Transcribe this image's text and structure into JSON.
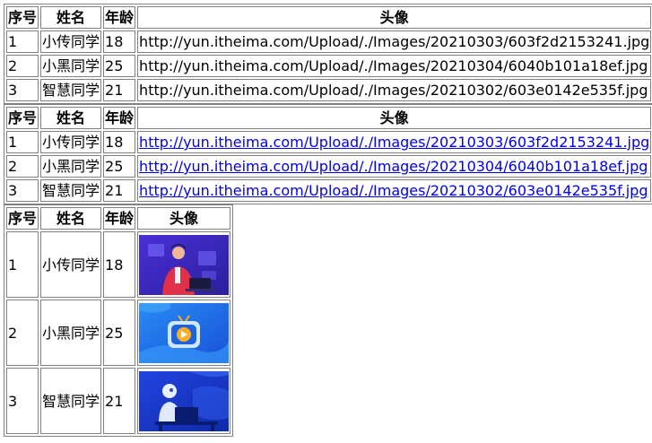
{
  "headers": [
    "序号",
    "姓名",
    "年龄",
    "头像"
  ],
  "rows": [
    {
      "id": "1",
      "name": "小传同学",
      "age": "18",
      "avatar_url": "http://yun.itheima.com/Upload/./Images/20210303/603f2d2153241.jpg",
      "avatar_icon": "person-at-laptop-illustration"
    },
    {
      "id": "2",
      "name": "小黑同学",
      "age": "25",
      "avatar_url": "http://yun.itheima.com/Upload/./Images/20210304/6040b101a18ef.jpg",
      "avatar_icon": "tv-play-button-illustration"
    },
    {
      "id": "3",
      "name": "智慧同学",
      "age": "21",
      "avatar_url": "http://yun.itheima.com/Upload/./Images/20210302/603e0142e535f.jpg",
      "avatar_icon": "robot-at-desk-illustration"
    }
  ],
  "colors": {
    "link": "#0000ee",
    "border": "#808080",
    "thumb_bg_1": "#3b2fd0",
    "thumb_bg_2": "#1f6fe8",
    "thumb_bg_3": "#1e3bd6"
  }
}
